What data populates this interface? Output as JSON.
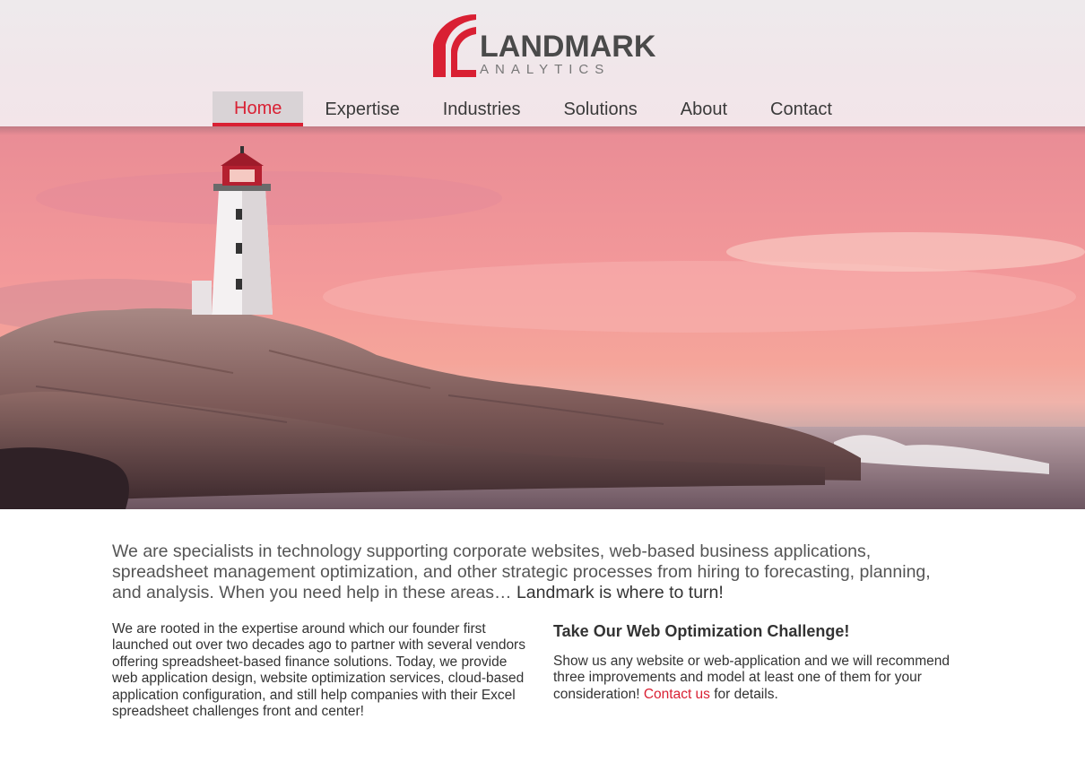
{
  "brand": {
    "name": "LANDMARK",
    "tagline": "ANALYTICS",
    "accent_color": "#d92033"
  },
  "nav": {
    "items": [
      "Home",
      "Expertise",
      "Industries",
      "Solutions",
      "About",
      "Contact"
    ],
    "active": "Home"
  },
  "hero": {
    "image": "lighthouse-on-rocks-at-sunset"
  },
  "intro": {
    "text": "We are specialists in technology supporting corporate websites, web-based business applications, spreadsheet management optimization, and other strategic processes from hiring to forecasting, planning, and analysis. When you need help in these areas…",
    "highlight": "Landmark is where to turn!"
  },
  "about": {
    "text": "We are rooted in the expertise around which our founder first launched out over two decades ago to partner with several vendors offering spreadsheet-based finance solutions. Today, we provide web application design, website optimization services, cloud-based application configuration, and still help companies with their Excel spreadsheet challenges front and center!"
  },
  "challenge": {
    "title": "Take Our Web Optimization Challenge!",
    "text_before": "Show us any website or web-application and we will recommend three improvements and model at least one of them for your consideration!",
    "link_label": "Contact us",
    "text_after": "for details."
  }
}
